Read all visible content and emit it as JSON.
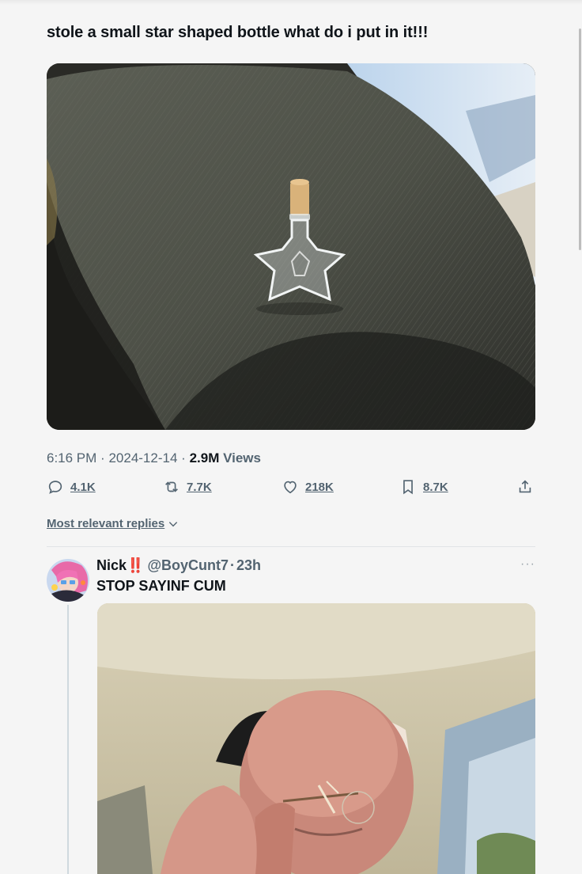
{
  "post": {
    "text": "stole a small star shaped bottle what do i put in it!!!",
    "time": "6:16 PM",
    "date": "2024-12-14",
    "views_count": "2.9M",
    "views_label": "Views",
    "sep": "·"
  },
  "actions": {
    "replies": "4.1K",
    "reposts": "7.7K",
    "likes": "218K",
    "bookmarks": "8.7K"
  },
  "replies_filter": {
    "label": "Most relevant replies"
  },
  "reply": {
    "name": "Nick",
    "emoji": "‼️",
    "handle": "@BoyCunt7",
    "sep": "·",
    "time": "23h",
    "more": "···",
    "text": "STOP SAYINF CUM"
  },
  "colors": {
    "muted": "#536471",
    "text": "#0f1419",
    "background": "#f5f5f5"
  }
}
